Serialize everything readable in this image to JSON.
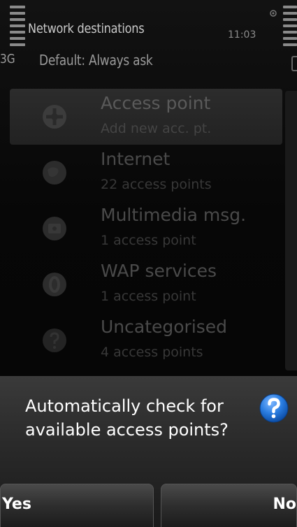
{
  "status": {
    "title": "Network destinations",
    "time": "11:03",
    "network_type": "3G",
    "default_connection": "Default: Always ask"
  },
  "list": {
    "items": [
      {
        "title": "Access point",
        "subtitle": "Add new acc. pt.",
        "icon": "add-access-point-icon"
      },
      {
        "title": "Internet",
        "subtitle": "22 access points",
        "icon": "globe-icon"
      },
      {
        "title": "Multimedia msg.",
        "subtitle": "1 access point",
        "icon": "multimedia-message-icon"
      },
      {
        "title": "WAP services",
        "subtitle": "1 access point",
        "icon": "wap-icon"
      },
      {
        "title": "Uncategorised",
        "subtitle": "4 access points",
        "icon": "question-mark-icon"
      }
    ]
  },
  "dialog": {
    "message": "Automatically check for available access points?",
    "icon": "question-icon",
    "icon_color": "#2a7de1"
  },
  "softkeys": {
    "left_label": "Yes",
    "right_label": "No"
  }
}
